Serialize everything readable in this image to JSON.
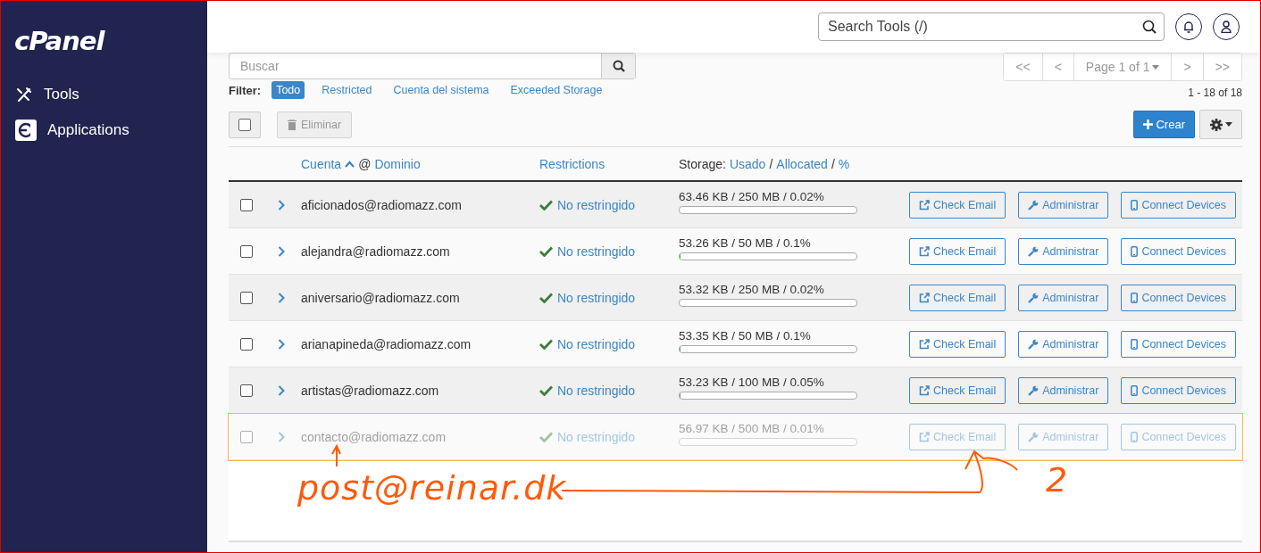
{
  "sidebar": {
    "logo": "cPanel",
    "items": [
      {
        "label": "Tools",
        "kind": "tools"
      },
      {
        "label": "Applications",
        "kind": "apps"
      }
    ]
  },
  "topbar": {
    "search": {
      "placeholder": "Search Tools (/)"
    }
  },
  "search": {
    "placeholder": "Buscar"
  },
  "pagination": {
    "first": "<<",
    "prev": "<",
    "page": "Page 1 of 1",
    "next": ">",
    "last": ">>",
    "count": "1 - 18 of 18"
  },
  "filter": {
    "label": "Filter:",
    "options": [
      {
        "label": "Todo",
        "selected": true
      },
      {
        "label": "Restricted",
        "selected": false
      },
      {
        "label": "Cuenta del sistema",
        "selected": false
      },
      {
        "label": "Exceeded Storage",
        "selected": false
      }
    ]
  },
  "toolbar": {
    "select_all": {
      "checked": false
    },
    "delete": {
      "label": "Eliminar",
      "disabled": true
    },
    "create": {
      "label": "Crear"
    }
  },
  "table": {
    "header": {
      "account": "Cuenta",
      "at": "@",
      "domain": "Dominio",
      "restrictions": "Restrictions",
      "storage": "Storage:",
      "used": "Usado",
      "sep_1": "/",
      "allocated": "Allocated",
      "sep_2": "/",
      "percent": "%"
    },
    "rows": [
      {
        "checked": false,
        "email": "aficionados@radiomazz.com",
        "restriction": "No restringido",
        "storage": "63.46 KB / 250 MB / 0.02%",
        "level": 0.0002,
        "dimmed": false,
        "highlighted": false,
        "actions": [
          "Check Email",
          "Administrar",
          "Connect Devices"
        ]
      },
      {
        "checked": false,
        "email": "alejandra@radiomazz.com",
        "restriction": "No restringido",
        "storage": "53.26 KB / 50 MB / 0.1%",
        "level": 0.001,
        "dimmed": false,
        "highlighted": false,
        "actions": [
          "Check Email",
          "Administrar",
          "Connect Devices"
        ]
      },
      {
        "checked": false,
        "email": "aniversario@radiomazz.com",
        "restriction": "No restringido",
        "storage": "53.32 KB / 250 MB / 0.02%",
        "level": 0.0002,
        "dimmed": false,
        "highlighted": false,
        "actions": [
          "Check Email",
          "Administrar",
          "Connect Devices"
        ]
      },
      {
        "checked": false,
        "email": "arianapineda@radiomazz.com",
        "restriction": "No restringido",
        "storage": "53.35 KB / 50 MB / 0.1%",
        "level": 0.001,
        "dimmed": false,
        "highlighted": false,
        "actions": [
          "Check Email",
          "Administrar",
          "Connect Devices"
        ]
      },
      {
        "checked": false,
        "email": "artistas@radiomazz.com",
        "restriction": "No restringido",
        "storage": "53.23 KB / 100 MB / 0.05%",
        "level": 0.0005,
        "dimmed": false,
        "highlighted": false,
        "actions": [
          "Check Email",
          "Administrar",
          "Connect Devices"
        ]
      },
      {
        "checked": false,
        "email": "contacto@radiomazz.com",
        "restriction": "No restringido",
        "storage": "56.97 KB / 500 MB / 0.01%",
        "level": 0.0001,
        "dimmed": true,
        "highlighted": true,
        "actions": [
          "Check Email",
          "Administrar",
          "Connect Devices"
        ]
      }
    ]
  },
  "annotations": [
    {
      "text": "post@reinar.dk"
    },
    {
      "text": "2"
    }
  ]
}
